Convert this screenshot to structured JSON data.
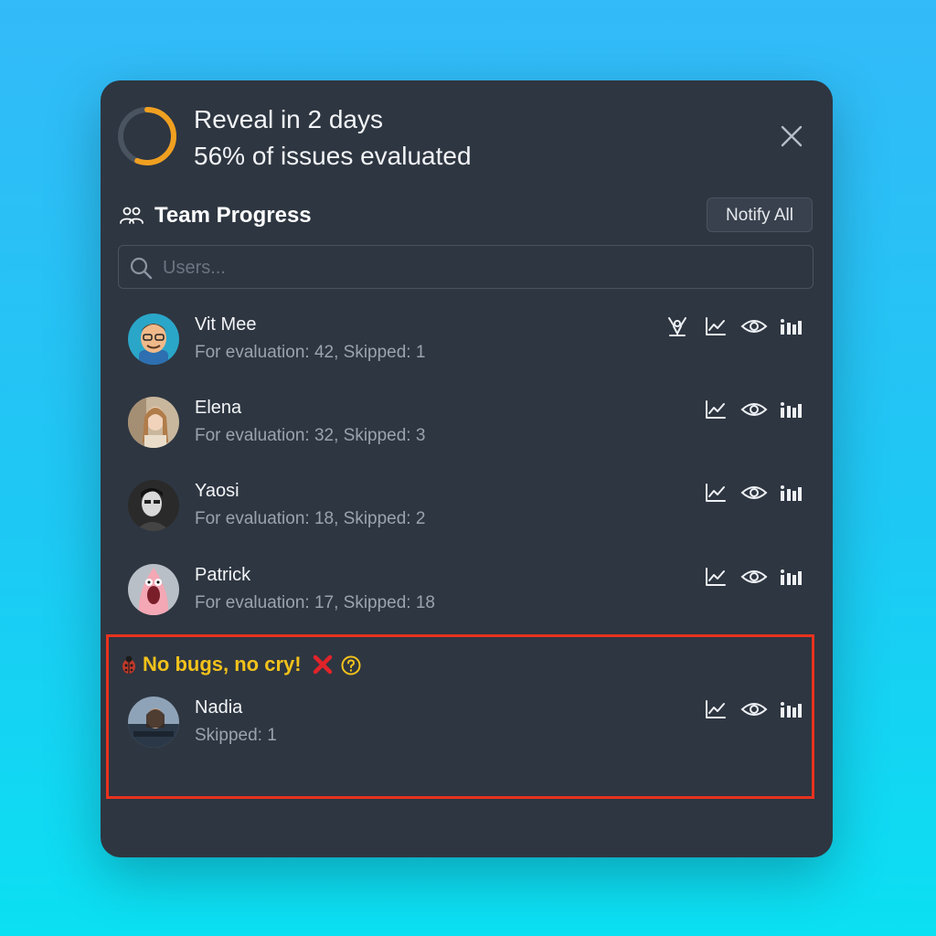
{
  "header": {
    "progress_percent": 56,
    "reveal_line": "Reveal in 2 days",
    "evaluated_line": "56% of issues evaluated",
    "ring_color": "#f0a020",
    "icons": [
      "progress-ring",
      "close-icon"
    ]
  },
  "team": {
    "title": "Team Progress",
    "notify_label": "Notify All",
    "search_placeholder": "Users..."
  },
  "users": [
    {
      "name": "Vit Mee",
      "stats": "For evaluation: 42, Skipped: 1",
      "icons": [
        "person-raising-arms-icon",
        "line-chart-icon",
        "eye-icon",
        "bar-chart-icon"
      ]
    },
    {
      "name": "Elena",
      "stats": "For evaluation: 32, Skipped: 3",
      "icons": [
        "line-chart-icon",
        "eye-icon",
        "bar-chart-icon"
      ]
    },
    {
      "name": "Yaosi",
      "stats": "For evaluation: 18, Skipped: 2",
      "icons": [
        "line-chart-icon",
        "eye-icon",
        "bar-chart-icon"
      ]
    },
    {
      "name": "Patrick",
      "stats": "For evaluation: 17, Skipped: 18",
      "icons": [
        "line-chart-icon",
        "eye-icon",
        "bar-chart-icon"
      ]
    }
  ],
  "achievement": {
    "title": "No bugs, no cry!",
    "title_color": "#f2c21b",
    "highlight_color": "#e8321e",
    "icons": [
      "ladybug-icon",
      "cross-mark-icon",
      "help-icon"
    ],
    "user": {
      "name": "Nadia",
      "stats": "Skipped: 1",
      "icons": [
        "line-chart-icon",
        "eye-icon",
        "bar-chart-icon"
      ]
    }
  }
}
